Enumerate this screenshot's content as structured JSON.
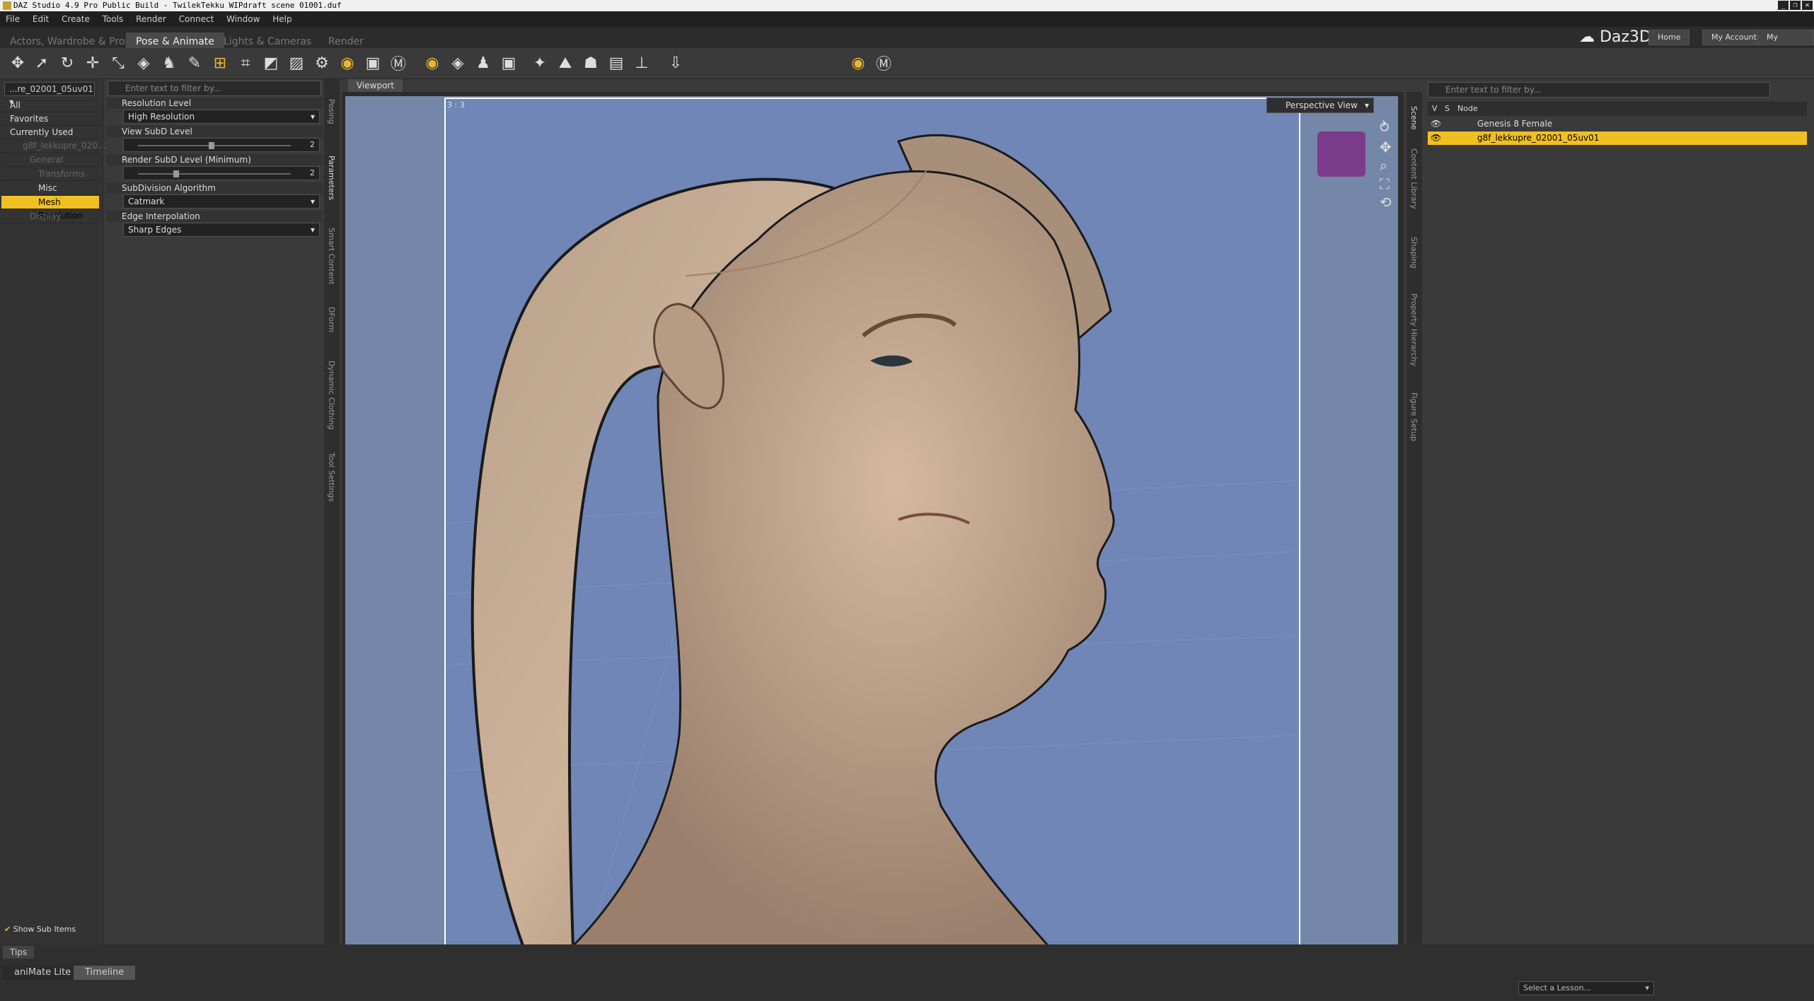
{
  "window": {
    "title": "DAZ Studio 4.9 Pro Public Build - TwilekTekku WIPdraft scene 01001.duf",
    "controls": [
      "_",
      "❐",
      "✕"
    ]
  },
  "menu": [
    "File",
    "Edit",
    "Create",
    "Tools",
    "Render",
    "Connect",
    "Window",
    "Help"
  ],
  "layout_tabs": [
    {
      "label": "Actors, Wardrobe & Props",
      "active": false
    },
    {
      "label": "Pose & Animate",
      "active": true
    },
    {
      "label": "Lights & Cameras",
      "active": false
    },
    {
      "label": "Render",
      "active": false
    }
  ],
  "brand": "Daz3D",
  "nav_buttons": [
    "Home",
    "My Account",
    "My Gallery"
  ],
  "left_panel": {
    "node_dropdown": "...re_02001_05uv01",
    "items": [
      {
        "label": "All"
      },
      {
        "label": "Favorites"
      },
      {
        "label": "Currently Used"
      },
      {
        "label": "g8f_lekkupre_020..."
      },
      {
        "label": "General"
      },
      {
        "label": "Transforms"
      },
      {
        "label": "Misc"
      },
      {
        "label": "Mesh Resolution"
      },
      {
        "label": "Display"
      }
    ],
    "show_sub_items": "Show Sub Items",
    "tips": "Tips"
  },
  "parameters": {
    "filter_placeholder": "Enter text to filter by...",
    "resolution_level": {
      "label": "Resolution Level",
      "value": "High Resolution"
    },
    "view_subd": {
      "label": "View SubD Level",
      "value": "2"
    },
    "render_subd": {
      "label": "Render SubD Level (Minimum)",
      "value": "2"
    },
    "subdiv_algo": {
      "label": "SubDivision Algorithm",
      "value": "Catmark"
    },
    "edge_interp": {
      "label": "Edge Interpolation",
      "value": "Sharp Edges"
    }
  },
  "left_vtabs": [
    "Posing",
    "Parameters",
    "Smart Content",
    "DForm",
    "Dynamic Clothing",
    "Tool Settings"
  ],
  "viewport": {
    "tab": "Viewport",
    "aspect": "3 : 3",
    "view_mode": "Perspective View"
  },
  "right_vtabs": [
    "Scene",
    "Content Library",
    "Shaping",
    "Property Hierarchy",
    "Figure Setup"
  ],
  "scene": {
    "filter_placeholder": "Enter text to filter by...",
    "col_v": "V",
    "col_s": "S",
    "col_node": "Node",
    "rows": [
      {
        "label": "Genesis 8 Female",
        "selected": false
      },
      {
        "label": "g8f_lekkupre_02001_05uv01",
        "selected": true
      }
    ]
  },
  "bottom_tabs": [
    {
      "label": "aniMate Lite",
      "active": false
    },
    {
      "label": "Timeline",
      "active": true
    }
  ],
  "lesson_select": "Select a Lesson...",
  "colors": {
    "accent": "#f0c020",
    "viewport_bg": "#7487a8"
  }
}
